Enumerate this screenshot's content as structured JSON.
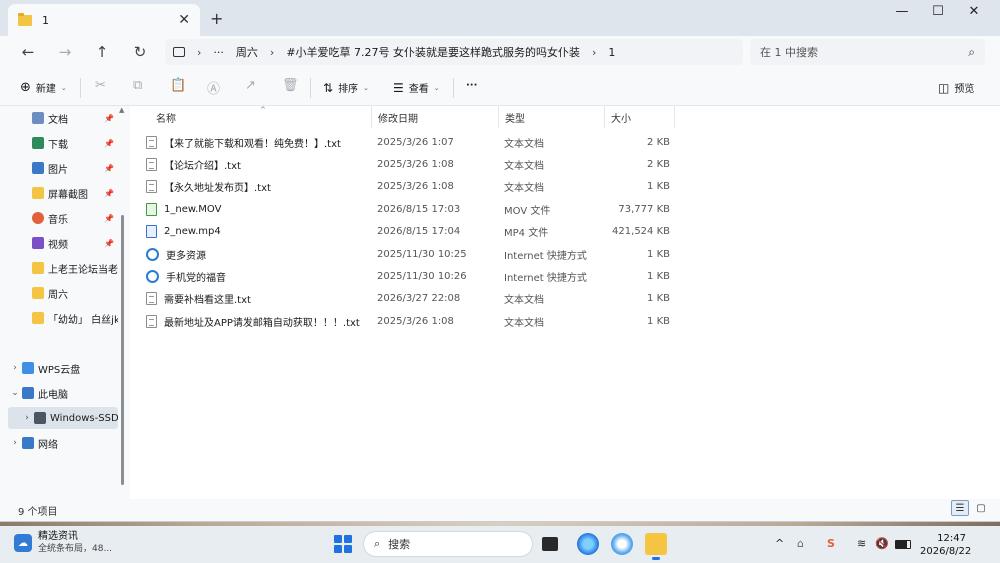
{
  "tab": {
    "title": "1",
    "close": "✕",
    "new_tab": "+"
  },
  "window_controls": {
    "minimize": "—",
    "maximize": "☐",
    "close": "✕"
  },
  "nav": {
    "back": "←",
    "forward": "→",
    "up": "↑",
    "refresh": "↻"
  },
  "address": {
    "sep": "›",
    "ellipsis": "···",
    "segments": [
      "周六",
      "#小羊爱吃草 7.27号 女仆装就是要这样跪式服务的吗女仆装",
      "1"
    ]
  },
  "search": {
    "placeholder": "在 1 中搜索",
    "icon": "search-icon"
  },
  "toolbar": {
    "new_label": "新建",
    "sort_label": "排序",
    "view_label": "查看",
    "more_label": "···",
    "preview_label": "预览",
    "caret": "⌄",
    "disabled_icons": [
      "✂",
      "⧉",
      "📋",
      "Ⓐ",
      "↗",
      "🗑"
    ]
  },
  "sidebar": {
    "items": [
      {
        "label": "文档",
        "icon": "documents-icon",
        "color": "#6a8fc0",
        "pinned": true
      },
      {
        "label": "下载",
        "icon": "download-icon",
        "color": "#2f8a5b",
        "pinned": true
      },
      {
        "label": "图片",
        "icon": "pictures-icon",
        "color": "#3a78c8",
        "pinned": true
      },
      {
        "label": "屏幕截图",
        "icon": "folder-icon",
        "color": "#f4c542",
        "pinned": true
      },
      {
        "label": "音乐",
        "icon": "music-icon",
        "color": "#e2603a",
        "pinned": true
      },
      {
        "label": "视频",
        "icon": "video-icon",
        "color": "#7a4fc8",
        "pinned": true
      },
      {
        "label": "上老王论坛当老王",
        "icon": "folder-icon",
        "color": "#f4c542",
        "pinned": false
      },
      {
        "label": "周六",
        "icon": "folder-icon",
        "color": "#f4c542",
        "pinned": false
      },
      {
        "label": "「幼幼」 白丝jk",
        "icon": "folder-icon",
        "color": "#f4c542",
        "pinned": false
      },
      {
        "label": "WPS云盘",
        "icon": "cloud-icon",
        "color": "#3f8ee8",
        "pinned": false
      },
      {
        "label": "此电脑",
        "icon": "pc-icon",
        "color": "#3a78c8",
        "pinned": false
      },
      {
        "label": "Windows-SSD",
        "icon": "drive-icon",
        "color": "#4b5563",
        "pinned": false
      },
      {
        "label": "网络",
        "icon": "network-icon",
        "color": "#3a78c8",
        "pinned": false
      }
    ],
    "pin_glyph": "📌"
  },
  "columns": {
    "name": "名称",
    "date": "修改日期",
    "type": "类型",
    "size": "大小"
  },
  "files": [
    {
      "name": "【来了就能下载和观看！纯免费！】.txt",
      "date": "2025/3/26 1:07",
      "type": "文本文档",
      "size": "2 KB",
      "kind": "txt"
    },
    {
      "name": "【论坛介绍】.txt",
      "date": "2025/3/26 1:08",
      "type": "文本文档",
      "size": "2 KB",
      "kind": "txt"
    },
    {
      "name": "【永久地址发布页】.txt",
      "date": "2025/3/26 1:08",
      "type": "文本文档",
      "size": "1 KB",
      "kind": "txt"
    },
    {
      "name": "1_new.MOV",
      "date": "2026/8/15 17:03",
      "type": "MOV 文件",
      "size": "73,777 KB",
      "kind": "mov"
    },
    {
      "name": "2_new.mp4",
      "date": "2026/8/15 17:04",
      "type": "MP4 文件",
      "size": "421,524 KB",
      "kind": "mp4"
    },
    {
      "name": "更多资源",
      "date": "2025/11/30 10:25",
      "type": "Internet 快捷方式",
      "size": "1 KB",
      "kind": "url"
    },
    {
      "name": "手机党的福音",
      "date": "2025/11/30 10:26",
      "type": "Internet 快捷方式",
      "size": "1 KB",
      "kind": "url"
    },
    {
      "name": "需要补档看这里.txt",
      "date": "2026/3/27 22:08",
      "type": "文本文档",
      "size": "1 KB",
      "kind": "txt"
    },
    {
      "name": "最新地址及APP请发邮箱自动获取！！！.txt",
      "date": "2025/3/26 1:08",
      "type": "文本文档",
      "size": "1 KB",
      "kind": "txt"
    }
  ],
  "status": {
    "item_count": "9 个项目"
  },
  "taskbar": {
    "news_title": "精选资讯",
    "news_sub": "全统条布局，48...",
    "search_label": "搜索",
    "tray_chevron": "^",
    "ime": "中",
    "volume": "🔇",
    "time": "12:47",
    "date": "2026/8/22"
  },
  "colors": {
    "accent": "#1f72e0",
    "folder": "#f4c542"
  }
}
